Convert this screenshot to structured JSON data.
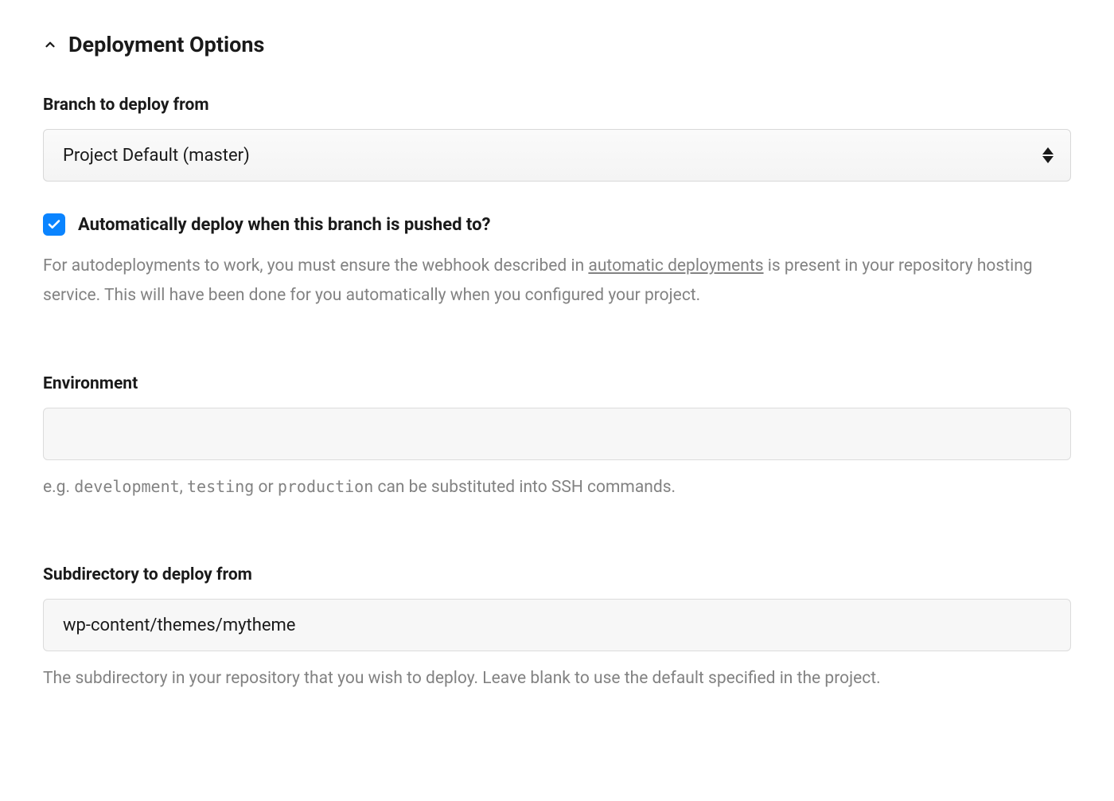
{
  "section": {
    "title": "Deployment Options"
  },
  "branch": {
    "label": "Branch to deploy from",
    "selected": "Project Default (master)"
  },
  "autodeploy": {
    "checkbox_label": "Automatically deploy when this branch is pushed to?",
    "help_prefix": "For autodeployments to work, you must ensure the webhook described in ",
    "help_link": "automatic deployments",
    "help_suffix": " is present in your repository hosting service. This will have been done for you automatically when you configured your project."
  },
  "environment": {
    "label": "Environment",
    "value": "",
    "help_prefix": "e.g. ",
    "help_code1": "development",
    "help_sep1": ", ",
    "help_code2": "testing",
    "help_sep2": " or ",
    "help_code3": "production",
    "help_suffix": " can be substituted into SSH commands."
  },
  "subdirectory": {
    "label": "Subdirectory to deploy from",
    "value": "wp-content/themes/mytheme",
    "help": "The subdirectory in your repository that you wish to deploy. Leave blank to use the default specified in the project."
  }
}
